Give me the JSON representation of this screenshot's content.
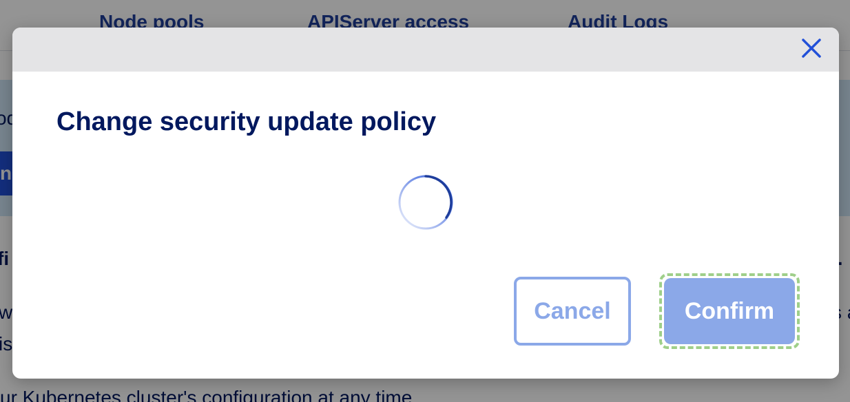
{
  "background": {
    "tabs": [
      {
        "label": "Node pools"
      },
      {
        "label": "APIServer access"
      },
      {
        "label": "Audit Logs"
      }
    ],
    "banner_fragment": "od",
    "banner_button_fragment": "ne",
    "left_fragments": [
      "fi",
      "w",
      "is",
      "ur Kubernetes cluster's configuration at any time"
    ],
    "right_fragments": [
      "l.",
      "s a"
    ]
  },
  "modal": {
    "title": "Change security update policy",
    "close_icon": "close-icon",
    "spinner_icon": "loading-spinner-icon",
    "cancel_label": "Cancel",
    "confirm_label": "Confirm",
    "colors": {
      "header_bg": "#e4e4e6",
      "title": "#00185e",
      "close": "#2250d8",
      "button_disabled": "#8ba8e8",
      "focus_ring": "#9fcf8a"
    }
  }
}
